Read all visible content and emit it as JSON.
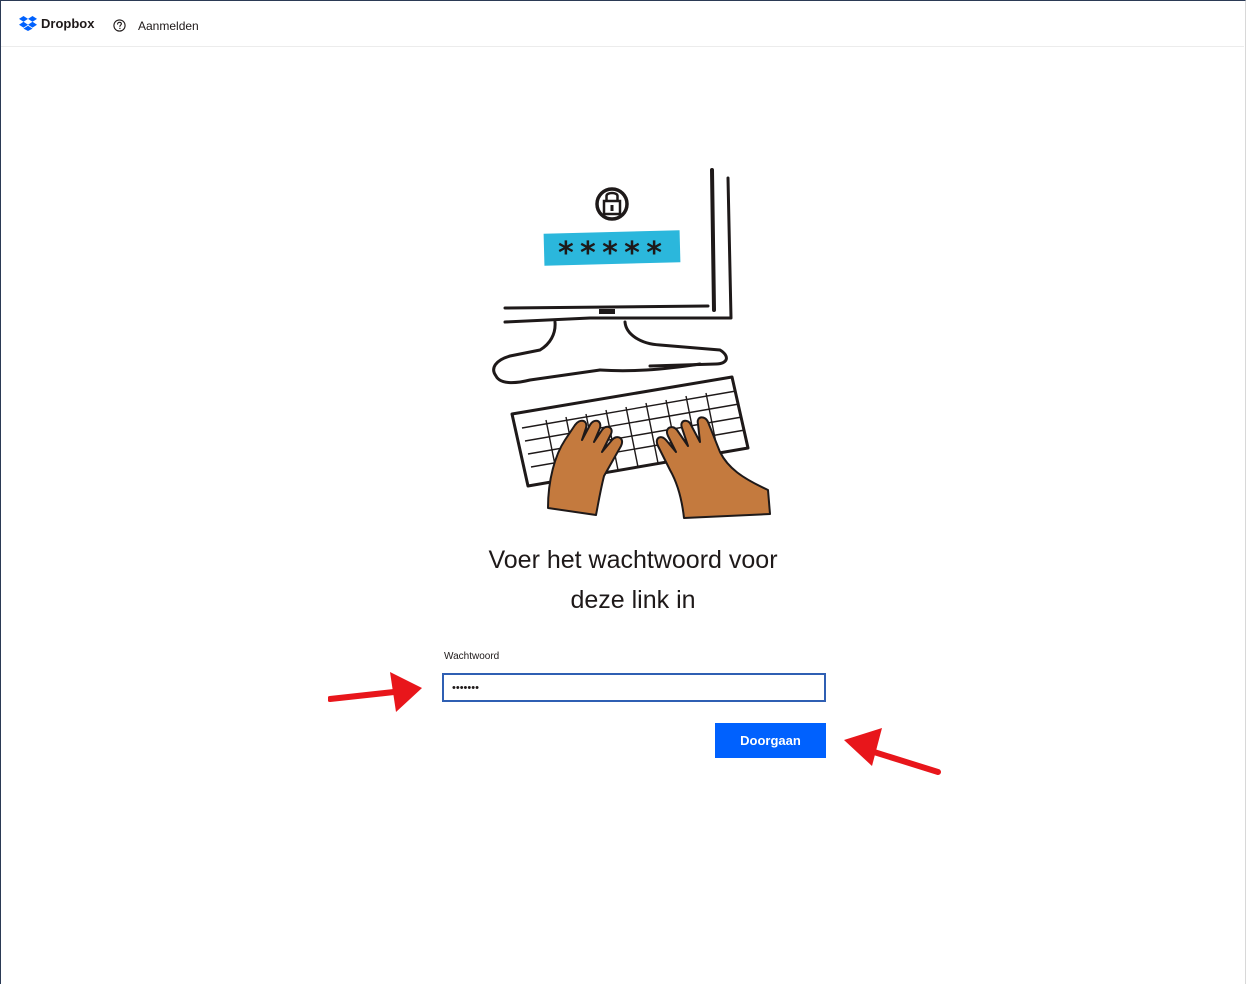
{
  "header": {
    "brand": "Dropbox",
    "help_icon": "help-circle-icon",
    "signin_label": "Aanmelden",
    "brand_color": "#0061fe"
  },
  "illustration": {
    "password_mask": "*****",
    "lock_icon": "lock-icon"
  },
  "main": {
    "heading_line1": "Voer het wachtwoord voor",
    "heading_line2": "deze link in",
    "password_label": "Wachtwoord",
    "password_value": "•••••••",
    "submit_label": "Doorgaan"
  },
  "colors": {
    "button": "#0061fe",
    "input_focus_border": "#2f5fb3",
    "annotation_arrow": "#e8161b",
    "mask_highlight": "#2bb7dc",
    "hand_skin": "#c47a3e"
  }
}
